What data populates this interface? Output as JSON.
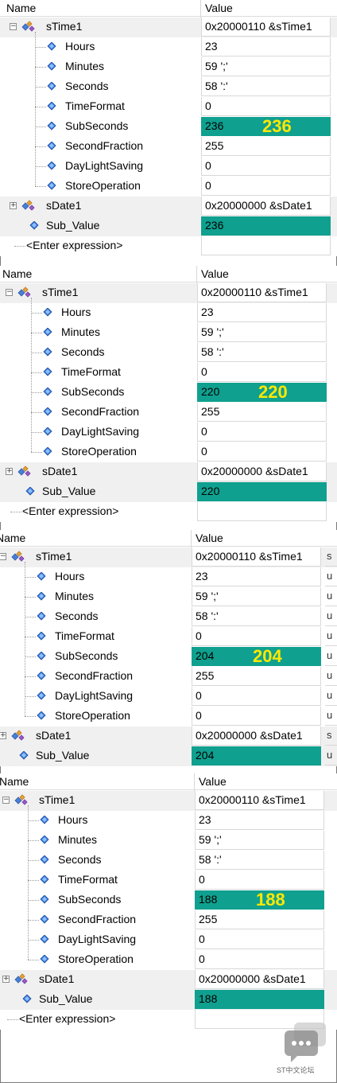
{
  "columns": {
    "name": "Name",
    "value": "Value"
  },
  "enter_expression": "<Enter expression>",
  "watermark": "ST中文论坛",
  "accent": "#0fa08f",
  "highlight_text_color": "#ffe800",
  "panels": [
    {
      "stime": {
        "name": "sTime1",
        "value": "0x20000110 &sTime1"
      },
      "fields": [
        {
          "name": "Hours",
          "value": "23"
        },
        {
          "name": "Minutes",
          "value": "59 ';'"
        },
        {
          "name": "Seconds",
          "value": "58 ':'"
        },
        {
          "name": "TimeFormat",
          "value": "0"
        },
        {
          "name": "SubSeconds",
          "value": "236"
        },
        {
          "name": "SecondFraction",
          "value": "255"
        },
        {
          "name": "DayLightSaving",
          "value": "0"
        },
        {
          "name": "StoreOperation",
          "value": "0"
        }
      ],
      "big_label": "236",
      "sdate": {
        "name": "sDate1",
        "value": "0x20000000 &sDate1"
      },
      "sub": {
        "name": "Sub_Value",
        "value": "236"
      }
    },
    {
      "stime": {
        "name": "sTime1",
        "value": "0x20000110 &sTime1"
      },
      "fields": [
        {
          "name": "Hours",
          "value": "23"
        },
        {
          "name": "Minutes",
          "value": "59 ';'"
        },
        {
          "name": "Seconds",
          "value": "58 ':'"
        },
        {
          "name": "TimeFormat",
          "value": "0"
        },
        {
          "name": "SubSeconds",
          "value": "220"
        },
        {
          "name": "SecondFraction",
          "value": "255"
        },
        {
          "name": "DayLightSaving",
          "value": "0"
        },
        {
          "name": "StoreOperation",
          "value": "0"
        }
      ],
      "big_label": "220",
      "sdate": {
        "name": "sDate1",
        "value": "0x20000000 &sDate1"
      },
      "sub": {
        "name": "Sub_Value",
        "value": "220"
      }
    },
    {
      "stime": {
        "name": "sTime1",
        "value": "0x20000110 &sTime1"
      },
      "fields": [
        {
          "name": "Hours",
          "value": "23"
        },
        {
          "name": "Minutes",
          "value": "59 ';'"
        },
        {
          "name": "Seconds",
          "value": "58 ':'"
        },
        {
          "name": "TimeFormat",
          "value": "0"
        },
        {
          "name": "SubSeconds",
          "value": "204"
        },
        {
          "name": "SecondFraction",
          "value": "255"
        },
        {
          "name": "DayLightSaving",
          "value": "0"
        },
        {
          "name": "StoreOperation",
          "value": "0"
        }
      ],
      "big_label": "204",
      "sdate": {
        "name": "sDate1",
        "value": "0x20000000 &sDate1"
      },
      "sub": {
        "name": "Sub_Value",
        "value": "204"
      },
      "ext_col": [
        "s",
        "u",
        "u",
        "u",
        "u",
        "u",
        "u",
        "u",
        "u",
        "s",
        "u"
      ]
    },
    {
      "stime": {
        "name": "sTime1",
        "value": "0x20000110 &sTime1"
      },
      "fields": [
        {
          "name": "Hours",
          "value": "23"
        },
        {
          "name": "Minutes",
          "value": "59 ';'"
        },
        {
          "name": "Seconds",
          "value": "58 ':'"
        },
        {
          "name": "TimeFormat",
          "value": "0"
        },
        {
          "name": "SubSeconds",
          "value": "188"
        },
        {
          "name": "SecondFraction",
          "value": "255"
        },
        {
          "name": "DayLightSaving",
          "value": "0"
        },
        {
          "name": "StoreOperation",
          "value": "0"
        }
      ],
      "big_label": "188",
      "sdate": {
        "name": "sDate1",
        "value": "0x20000000 &sDate1"
      },
      "sub": {
        "name": "Sub_Value",
        "value": "188"
      }
    }
  ]
}
